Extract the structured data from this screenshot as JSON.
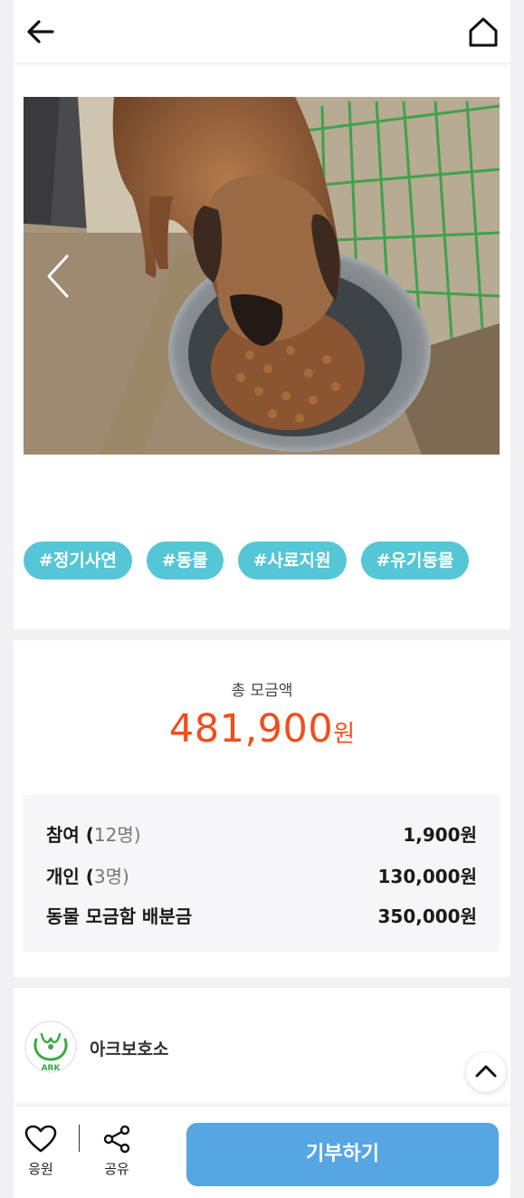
{
  "header": {
    "back_icon": "arrow-left-icon",
    "home_icon": "home-icon"
  },
  "hero": {
    "prev_icon": "chevron-left-icon"
  },
  "tags": [
    "#정기사연",
    "#동물",
    "#사료지원",
    "#유기동물"
  ],
  "total": {
    "label": "총 모금액",
    "amount": "481,900",
    "unit": "원"
  },
  "breakdown": {
    "rows": [
      {
        "label": "참여 (",
        "count": "12명",
        "close": ")",
        "value": "1,900원"
      },
      {
        "label": "개인 (",
        "count": "3명",
        "close": ")",
        "value": "130,000원"
      },
      {
        "label": "동물 모금함 배분금",
        "count": "",
        "close": "",
        "value": "350,000원"
      }
    ]
  },
  "organization": {
    "name": "아크보호소",
    "logo_text": "ARK"
  },
  "bottom_bar": {
    "cheer_label": "응원",
    "share_label": "공유",
    "donate_label": "기부하기"
  },
  "colors": {
    "tag_bg": "#54c6d6",
    "amount": "#f04e1c",
    "donate_bg": "#55a6e2",
    "logo_green": "#3aaa45"
  }
}
